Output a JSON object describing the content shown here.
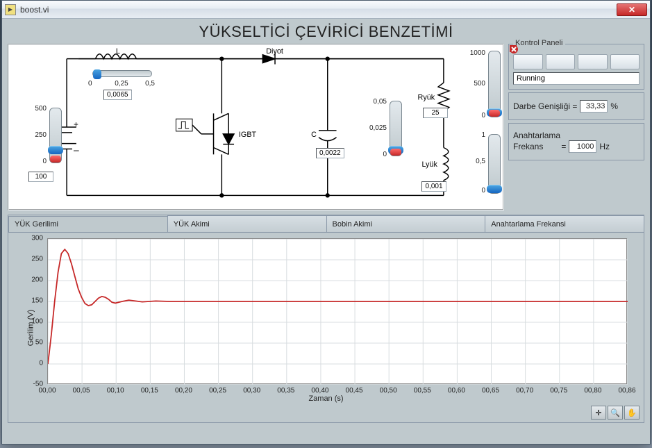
{
  "window": {
    "title": "boost.vi",
    "icon_text": "▶"
  },
  "main_title": "YÜKSELTİCİ ÇEVİRİCİ BENZETİMİ",
  "circuit": {
    "labels": {
      "L": "L",
      "Diyot": "Diyot",
      "IGBT": "IGBT",
      "C": "C",
      "Ryuk": "Ryük",
      "Lyuk": "Lyük",
      "plus": "+",
      "minus": "–"
    },
    "inputs": {
      "Vin": {
        "value": "100",
        "ticks": [
          "500",
          "250",
          "0"
        ]
      },
      "L": {
        "value": "0,0065",
        "ticks": [
          "0",
          "0,25",
          "0,5"
        ]
      },
      "C": {
        "value": "0,0022",
        "ticks": [
          "0,05",
          "0,025",
          "0"
        ]
      },
      "Ryuk": {
        "value": "25",
        "ticks": [
          "1000",
          "500",
          "0"
        ]
      },
      "Lyuk": {
        "value": "0,001",
        "ticks": [
          "1",
          "0,5",
          "0"
        ]
      }
    }
  },
  "control": {
    "legend": "Kontrol Paneli",
    "buttons": {
      "run": "run-icon",
      "pause": "pause-icon",
      "stop": "stop-icon",
      "abort": "abort-icon"
    },
    "status": "Running",
    "duty": {
      "label": "Darbe Genişliği =",
      "value": "33,33",
      "unit": "%"
    },
    "freq": {
      "label1": "Anahtarlama",
      "label2": "Frekans",
      "eq": "=",
      "value": "1000",
      "unit": "Hz"
    }
  },
  "tabs": [
    "YÜK Gerilimi",
    "YÜK Akimi",
    "Bobin Akimi",
    "Anahtarlama Frekansi"
  ],
  "chart_data": {
    "type": "line",
    "title": "",
    "xlabel": "Zaman (s)",
    "ylabel": "Gerilim (V)",
    "xlim": [
      0.0,
      0.86
    ],
    "ylim": [
      -50,
      300
    ],
    "x_ticks": [
      "00,00",
      "00,05",
      "00,10",
      "00,15",
      "00,20",
      "00,25",
      "00,30",
      "00,35",
      "00,40",
      "00,45",
      "00,50",
      "00,55",
      "00,60",
      "00,65",
      "00,70",
      "00,75",
      "00,80",
      "00,86"
    ],
    "y_ticks": [
      "300",
      "250",
      "200",
      "150",
      "100",
      "50",
      "0",
      "-50"
    ],
    "x": [
      0.0,
      0.005,
      0.01,
      0.015,
      0.02,
      0.025,
      0.03,
      0.035,
      0.04,
      0.045,
      0.05,
      0.055,
      0.06,
      0.065,
      0.07,
      0.075,
      0.08,
      0.085,
      0.09,
      0.095,
      0.1,
      0.11,
      0.12,
      0.13,
      0.14,
      0.15,
      0.16,
      0.18,
      0.2,
      0.25,
      0.3,
      0.4,
      0.5,
      0.6,
      0.7,
      0.8,
      0.86
    ],
    "values": [
      0,
      70,
      150,
      220,
      265,
      275,
      265,
      240,
      210,
      180,
      160,
      145,
      140,
      142,
      150,
      158,
      162,
      160,
      155,
      148,
      146,
      150,
      153,
      151,
      149,
      150,
      151,
      150,
      150,
      150,
      150,
      150,
      150,
      150,
      150,
      150,
      150
    ],
    "color": "#c62828"
  }
}
